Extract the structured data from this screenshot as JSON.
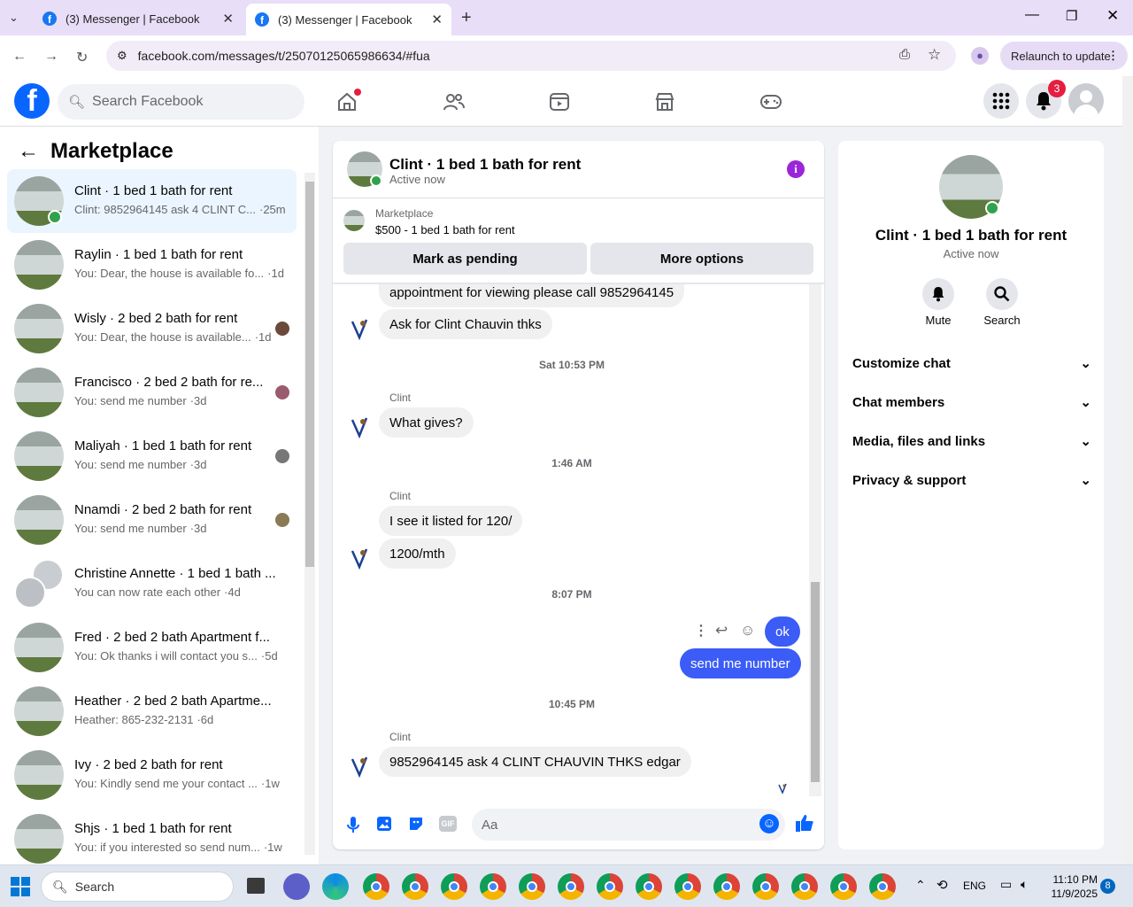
{
  "browser": {
    "tabs": [
      {
        "title": "(3) Messenger | Facebook"
      },
      {
        "title": "(3) Messenger | Facebook"
      }
    ],
    "url": "facebook.com/messages/t/25070125065986634/#fua",
    "relaunch": "Relaunch to update"
  },
  "fb": {
    "search_placeholder": "Search Facebook",
    "notifications_count": "3"
  },
  "left": {
    "title": "Marketplace",
    "conversations": [
      {
        "name": "Clint · 1 bed 1 bath for rent",
        "preview": "Clint: 9852964145 ask 4 CLINT C...",
        "time": "·25m"
      },
      {
        "name": "Raylin · 1 bed 1 bath for rent",
        "preview": "You: Dear, the house is available fo...",
        "time": "·1d"
      },
      {
        "name": "Wisly · 2 bed 2 bath for rent",
        "preview": "You: Dear, the house is available...",
        "time": "·1d"
      },
      {
        "name": "Francisco · 2 bed 2 bath for re...",
        "preview": "You: send me number",
        "time": "·3d"
      },
      {
        "name": "Maliyah · 1 bed 1 bath for rent",
        "preview": "You: send me number",
        "time": "·3d"
      },
      {
        "name": "Nnamdi · 2 bed 2 bath for rent",
        "preview": "You: send me number",
        "time": "·3d"
      },
      {
        "name": "Christine Annette · 1 bed 1 bath ...",
        "preview": "You can now rate each other",
        "time": "·4d"
      },
      {
        "name": "Fred · 2 bed 2 bath Apartment f...",
        "preview": "You: Ok thanks i will contact you s...",
        "time": "·5d"
      },
      {
        "name": "Heather · 2 bed 2 bath Apartme...",
        "preview": "Heather: 865-232-2131",
        "time": "·6d"
      },
      {
        "name": "Ivy · 2 bed 2 bath for rent",
        "preview": "You: Kindly send me your contact ...",
        "time": "·1w"
      },
      {
        "name": "Shjs · 1 bed 1 bath for rent",
        "preview": "You: if you interested so send num...",
        "time": "·1w"
      }
    ]
  },
  "chat": {
    "title": "Clint · 1 bed 1 bath for rent",
    "status": "Active now",
    "listing_label": "Marketplace",
    "listing_title": "$500 - 1 bed 1 bath for rent",
    "btn_pending": "Mark as pending",
    "btn_more": "More options",
    "messages": {
      "m1": "appointment for viewing please call 9852964145",
      "m2": "Ask for Clint Chauvin thks",
      "ts1": "Sat 10:53 PM",
      "sender": "Clint",
      "m3": "What gives?",
      "ts2": "1:46 AM",
      "m4": "I see it listed for 120/",
      "m5": "1200/mth",
      "ts3": "8:07 PM",
      "m6": "ok",
      "m7": "send me number",
      "ts4": "10:45 PM",
      "m8": "9852964145 ask 4 CLINT CHAUVIN THKS edgar"
    },
    "input_placeholder": "Aa"
  },
  "right": {
    "name": "Clint · 1 bed 1 bath for rent",
    "status": "Active now",
    "mute": "Mute",
    "search": "Search",
    "sections": [
      "Customize chat",
      "Chat members",
      "Media, files and links",
      "Privacy & support"
    ]
  },
  "taskbar": {
    "search": "Search",
    "lang": "ENG",
    "time": "11:10 PM",
    "date": "11/9/2025",
    "badge": "8"
  }
}
